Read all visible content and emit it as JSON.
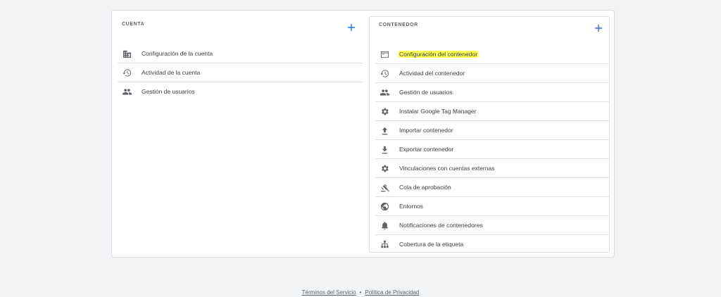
{
  "account": {
    "title": "CUENTA",
    "items": [
      {
        "label": "Configuración de la cuenta",
        "icon": "building-icon"
      },
      {
        "label": "Actividad de la cuenta",
        "icon": "history-icon"
      },
      {
        "label": "Gestión de usuarios",
        "icon": "people-icon"
      }
    ]
  },
  "container": {
    "title": "CONTENEDOR",
    "items": [
      {
        "label": "Configuración del contenedor",
        "icon": "web-window-icon",
        "highlighted": true
      },
      {
        "label": "Actividad del contenedor",
        "icon": "history-icon"
      },
      {
        "label": "Gestión de usuarios",
        "icon": "people-icon"
      },
      {
        "label": "Instalar Google Tag Manager",
        "icon": "gear-icon"
      },
      {
        "label": "Importar contenedor",
        "icon": "upload-icon"
      },
      {
        "label": "Exportar contenedor",
        "icon": "download-icon"
      },
      {
        "label": "Vinculaciones con cuentas externas",
        "icon": "gear-icon"
      },
      {
        "label": "Cola de aprobación",
        "icon": "gavel-icon"
      },
      {
        "label": "Entornos",
        "icon": "globe-icon"
      },
      {
        "label": "Notificaciones de contenedores",
        "icon": "bell-icon"
      },
      {
        "label": "Cobertura de la etiqueta",
        "icon": "sitemap-icon"
      }
    ]
  },
  "footer": {
    "terms": "Términos del Servicio",
    "separator": "•",
    "privacy": "Política de Privacidad"
  },
  "colors": {
    "accent": "#1a73e8",
    "highlight": "#fcff54",
    "icon": "#5f6368"
  }
}
